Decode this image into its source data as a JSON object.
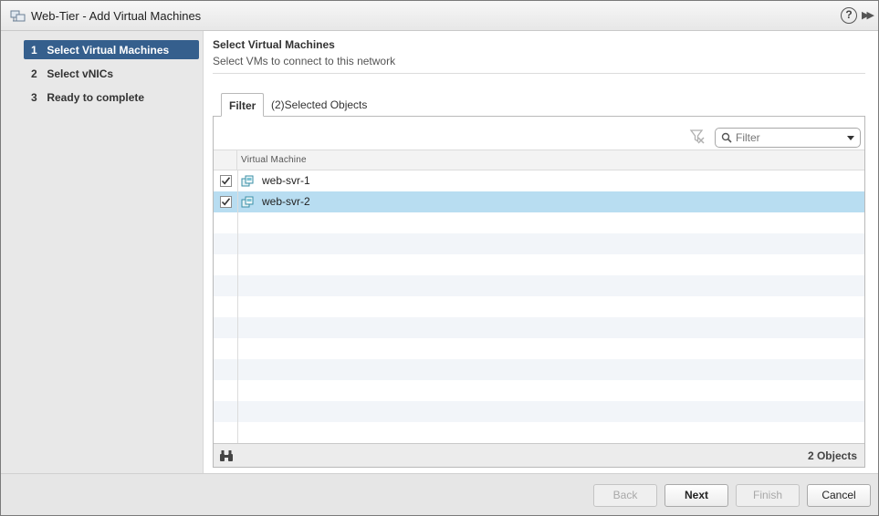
{
  "window": {
    "title": "Web-Tier - Add Virtual Machines",
    "help_label": "?",
    "expand_label": "▶▶"
  },
  "steps": [
    {
      "num": "1",
      "label": "Select Virtual Machines",
      "active": true
    },
    {
      "num": "2",
      "label": "Select vNICs",
      "active": false
    },
    {
      "num": "3",
      "label": "Ready to complete",
      "active": false
    }
  ],
  "main": {
    "title": "Select Virtual Machines",
    "subtitle": "Select VMs to connect to this network"
  },
  "tabs": [
    {
      "label": "Filter",
      "active": true
    },
    {
      "label": "(2)Selected Objects",
      "active": false
    }
  ],
  "filter": {
    "placeholder": "Filter"
  },
  "grid": {
    "column_header": "Virtual Machine",
    "rows": [
      {
        "name": "web-svr-1",
        "checked": true,
        "selected": false
      },
      {
        "name": "web-svr-2",
        "checked": true,
        "selected": true
      }
    ],
    "footer_count": "2 Objects"
  },
  "buttons": {
    "back": "Back",
    "next": "Next",
    "finish": "Finish",
    "cancel": "Cancel"
  },
  "colors": {
    "active_step": "#355f8d",
    "selected_row": "#b8ddf1"
  }
}
